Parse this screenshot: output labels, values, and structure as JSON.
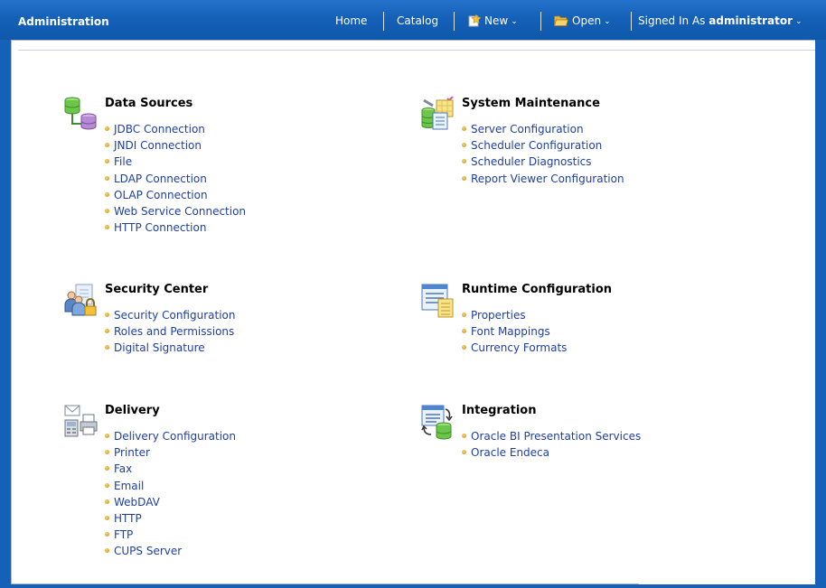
{
  "header": {
    "title": "Administration",
    "nav": {
      "home": "Home",
      "catalog": "Catalog",
      "new": "New",
      "open": "Open",
      "signed_in_prefix": "Signed In As",
      "user": "administrator"
    }
  },
  "sections": {
    "data_sources": {
      "icon": "database-icon",
      "title": "Data Sources",
      "links": [
        "JDBC Connection",
        "JNDI Connection",
        "File",
        "LDAP Connection",
        "OLAP Connection",
        "Web Service Connection",
        "HTTP Connection"
      ]
    },
    "system_maintenance": {
      "icon": "server-maintenance-icon",
      "title": "System Maintenance",
      "links": [
        "Server Configuration",
        "Scheduler Configuration",
        "Scheduler Diagnostics",
        "Report Viewer Configuration"
      ]
    },
    "security_center": {
      "icon": "users-lock-icon",
      "title": "Security Center",
      "links": [
        "Security Configuration",
        "Roles and Permissions",
        "Digital Signature"
      ]
    },
    "runtime_configuration": {
      "icon": "runtime-config-icon",
      "title": "Runtime Configuration",
      "links": [
        "Properties",
        "Font Mappings",
        "Currency Formats"
      ]
    },
    "delivery": {
      "icon": "delivery-icon",
      "title": "Delivery",
      "links": [
        "Delivery Configuration",
        "Printer",
        "Fax",
        "Email",
        "WebDAV",
        "HTTP",
        "FTP",
        "CUPS Server"
      ]
    },
    "integration": {
      "icon": "integration-icon",
      "title": "Integration",
      "links": [
        "Oracle BI Presentation Services",
        "Oracle Endeca"
      ]
    }
  },
  "colors": {
    "header_blue": "#1561b8",
    "link_blue": "#1f3fa0",
    "bullet_gold": "#c8901c"
  }
}
